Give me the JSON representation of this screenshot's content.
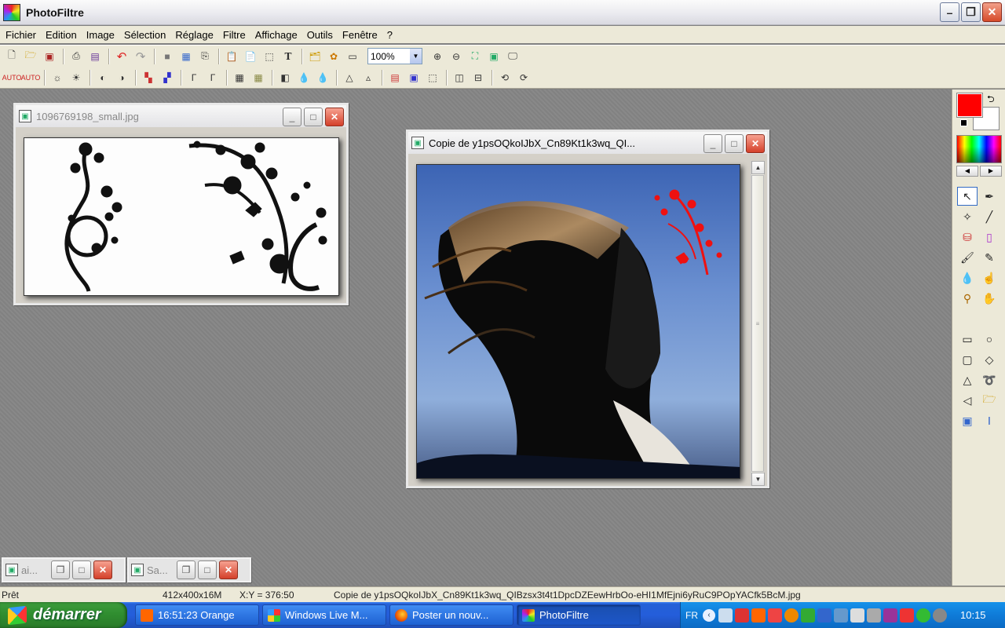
{
  "app": {
    "title": "PhotoFiltre"
  },
  "menu": [
    "Fichier",
    "Edition",
    "Image",
    "Sélection",
    "Réglage",
    "Filtre",
    "Affichage",
    "Outils",
    "Fenêtre",
    "?"
  ],
  "toolbar": {
    "zoom_value": "100%"
  },
  "windows": {
    "small": {
      "title": "1096769198_small.jpg"
    },
    "copy": {
      "title": "Copie de y1psOQkoIJbX_Cn89Kt1k3wq_QI..."
    },
    "mini1": {
      "title": "ai..."
    },
    "mini2": {
      "title": "Sa..."
    }
  },
  "palette": {
    "fg_color": "#ff0000",
    "bg_color": "#ffffff"
  },
  "status": {
    "state": "Prêt",
    "dims": "412x400x16M",
    "coords": "X:Y = 376:50",
    "filename": "Copie de y1psOQkoIJbX_Cn89Kt1k3wq_QIBzsx3t4t1DpcDZEewHrbOo-eHI1MfEjni6yRuC9POpYACfk5BcM.jpg"
  },
  "taskbar": {
    "start_label": "démarrer",
    "tasks": [
      {
        "label": "16:51:23 Orange"
      },
      {
        "label": "Windows Live M..."
      },
      {
        "label": "Poster un nouv..."
      },
      {
        "label": "PhotoFiltre"
      }
    ],
    "lang": "FR",
    "clock": "10:15"
  }
}
